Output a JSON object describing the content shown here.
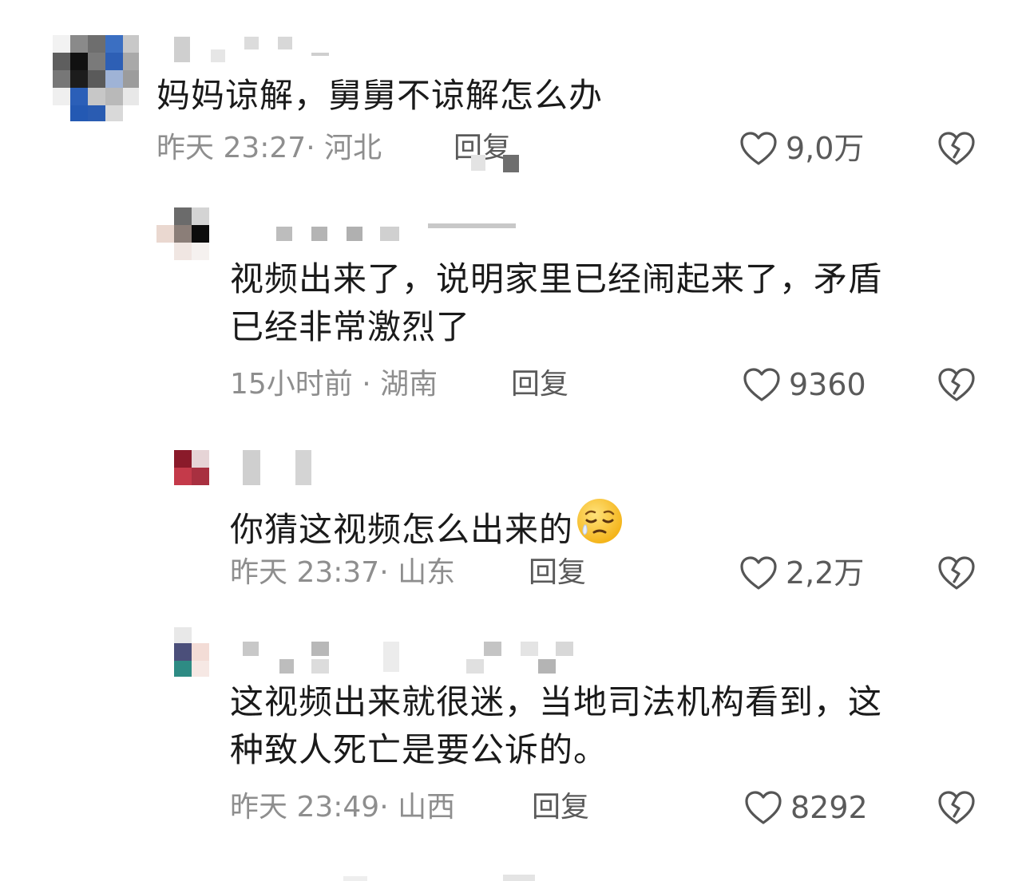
{
  "comments": [
    {
      "text": "妈妈谅解，舅舅不谅解怎么办",
      "time": "昨天 23:27",
      "sep": "·",
      "location": "河北",
      "reply_label": "回复",
      "likes": "9,0万"
    },
    {
      "text_line1": "视频出来了，说明家里已经闹起来了，矛盾",
      "text_line2": "已经非常激烈了",
      "time": "15小时前",
      "sep": "·",
      "location": "湖南",
      "reply_label": "回复",
      "likes": "9360"
    },
    {
      "text": "你猜这视频怎么出来的",
      "emoji": "sad-face-emoji",
      "time": "昨天 23:37",
      "sep": "·",
      "location": "山东",
      "reply_label": "回复",
      "likes": "2,2万"
    },
    {
      "text_line1": "这视频出来就很迷，当地司法机构看到，这",
      "text_line2": "种致人死亡是要公诉的。",
      "time": "昨天 23:49",
      "sep": "·",
      "location": "山西",
      "reply_label": "回复",
      "likes": "8292"
    }
  ],
  "icons": {
    "like": "heart-outline-icon",
    "dislike": "broken-heart-icon"
  },
  "colors": {
    "text": "#1a1a1a",
    "meta": "#8e8e8e",
    "action": "#5a5a5a"
  }
}
